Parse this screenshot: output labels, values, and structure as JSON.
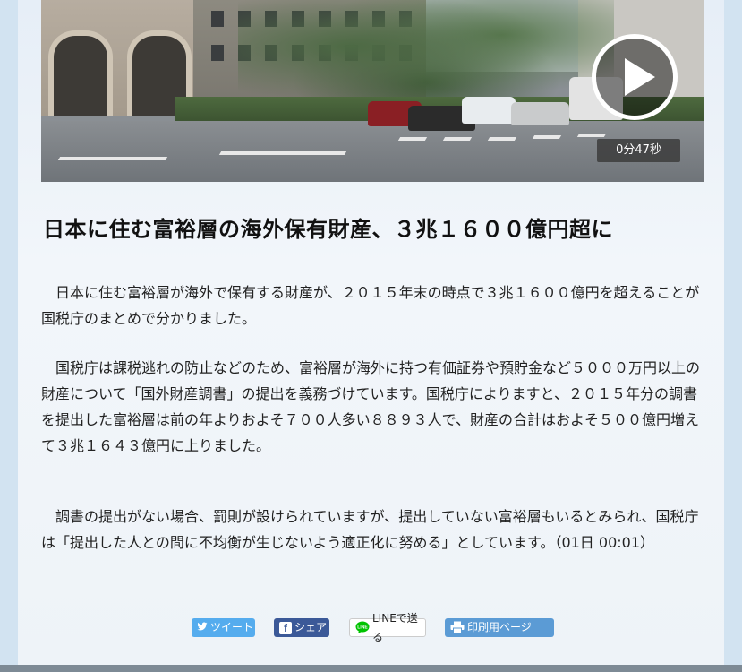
{
  "video": {
    "duration": "0分47秒",
    "play_icon": "play-icon"
  },
  "article": {
    "headline": "日本に住む富裕層の海外保有財産、３兆１６００億円超に",
    "paragraphs": [
      "日本に住む富裕層が海外で保有する財産が、２０１５年末の時点で３兆１６００億円を超えることが国税庁のまとめで分かりました。",
      "国税庁は課税逃れの防止などのため、富裕層が海外に持つ有価証券や預貯金など５０００万円以上の財産について「国外財産調書」の提出を義務づけています。国税庁によりますと、２０１５年分の調書を提出した富裕層は前の年よりおよそ７００人多い８８９３人で、財産の合計はおよそ５００億円増えて３兆１６４３億円に上りました。",
      "調書の提出がない場合、罰則が設けられていますが、提出していない富裕層もいるとみられ、国税庁は「提出した人との間に不均衡が生じないよう適正化に努める」としています。（01日 00:01）"
    ]
  },
  "share": {
    "tweet_label": "ツイート",
    "facebook_label": "シェア",
    "line_label": "LINEで送る",
    "print_label": "印刷用ページ"
  },
  "colors": {
    "twitter": "#55acee",
    "facebook": "#3b5998",
    "print": "#5b9bd5",
    "line_green": "#00c300"
  }
}
